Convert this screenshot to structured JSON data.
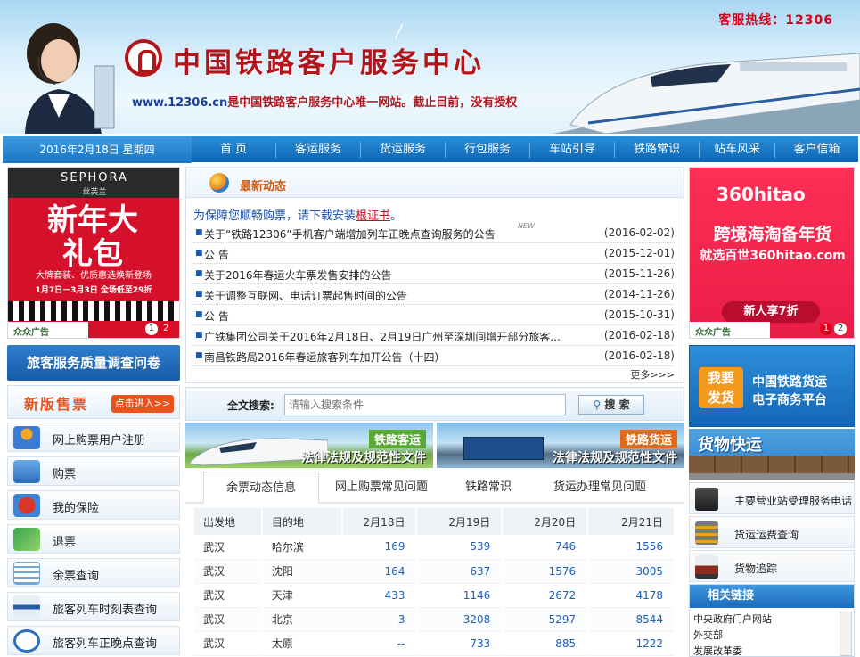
{
  "header": {
    "hotline": "客服热线：12306",
    "title": "中国铁路客户服务中心",
    "url": "www.12306.cn",
    "desc": "是中国铁路客户服务中心唯一网站。截止目前，没有授权"
  },
  "nav": {
    "date": "2016年2月18日 星期四",
    "items": [
      "首 页",
      "客运服务",
      "货运服务",
      "行包服务",
      "车站引导",
      "铁路常识",
      "站车风采",
      "客户信箱"
    ]
  },
  "ads": {
    "sephora": {
      "brand": "SEPHORA",
      "brand_cn": "丝芙兰",
      "headline": "新年大礼包",
      "line1": "大牌套装、优质惠选焕新登场",
      "line2": "1月7日－3月3日 全场低至29折",
      "corner": "众众广告",
      "pages": [
        "1",
        "2"
      ]
    },
    "hitao": {
      "logo": "360hitao",
      "line1": "跨境海淘备年货",
      "line2": "就选百世360hitao.com",
      "button": "新人享7折",
      "corner": "众众广告",
      "pages": [
        "1",
        "2"
      ]
    }
  },
  "left": {
    "survey": "旅客服务质量调查问卷",
    "newticket": "新版售票",
    "newticket_btn": "点击进入>>",
    "menu": [
      "网上购票用户注册",
      "购票",
      "我的保险",
      "退票",
      "余票查询",
      "旅客列车时刻表查询",
      "旅客列车正晚点查询"
    ]
  },
  "news": {
    "title": "最新动态",
    "notice_pre": "为保障您顺畅购票，请下载安装",
    "notice_link": "根证书",
    "notice_post": "。",
    "new_badge": "NEW",
    "items": [
      {
        "title": "关于“铁路12306”手机客户端增加列车正晚点查询服务的公告",
        "date": "(2016-02-02)"
      },
      {
        "title": "公 告",
        "date": "(2015-12-01)"
      },
      {
        "title": "关于2016年春运火车票发售安排的公告",
        "date": "(2015-11-26)"
      },
      {
        "title": "关于调整互联网、电话订票起售时间的公告",
        "date": "(2014-11-26)"
      },
      {
        "title": "公 告",
        "date": "(2015-10-31)"
      },
      {
        "title": "广铁集团公司关于2016年2月18日、2月19日广州至深圳间增开部分旅客...",
        "date": "(2016-02-18)"
      },
      {
        "title": "南昌铁路局2016年春运旅客列车加开公告（十四）",
        "date": "(2016-02-18)"
      }
    ],
    "more": "更多>>>"
  },
  "search": {
    "label": "全文搜索:",
    "placeholder": "请输入搜索条件",
    "button": "搜 索"
  },
  "categories": {
    "passenger_tag": "铁路客运",
    "passenger_sub": "法律法规及规范性文件",
    "freight_tag": "铁路货运",
    "freight_sub": "法律法规及规范性文件"
  },
  "tabs": [
    "余票动态信息",
    "网上购票常见问题",
    "铁路常识",
    "货运办理常见问题"
  ],
  "ticket_table": {
    "headers": [
      "出发地",
      "目的地",
      "2月18日",
      "2月19日",
      "2月20日",
      "2月21日"
    ],
    "rows": [
      [
        "武汉",
        "哈尔滨",
        "169",
        "539",
        "746",
        "1556"
      ],
      [
        "武汉",
        "沈阳",
        "164",
        "637",
        "1576",
        "3005"
      ],
      [
        "武汉",
        "天津",
        "433",
        "1146",
        "2672",
        "4178"
      ],
      [
        "武汉",
        "北京",
        "3",
        "3208",
        "5297",
        "8544"
      ],
      [
        "武汉",
        "太原",
        "--",
        "733",
        "885",
        "1222"
      ]
    ]
  },
  "right": {
    "ec_badge1": "我要",
    "ec_badge2": "发货",
    "ec_title1": "中国铁路货运",
    "ec_title2": "电子商务平台",
    "cargo": "货物快运",
    "menu": [
      "主要营业站受理服务电话",
      "货运运费查询",
      "货物追踪"
    ],
    "links_title": "相关链接",
    "links": [
      "中央政府门户网站",
      "外交部",
      "发展改革委"
    ]
  },
  "colors": {
    "brand_red": "#b3151c",
    "nav_blue": "#1470bf",
    "link_blue": "#1a5fb4"
  }
}
